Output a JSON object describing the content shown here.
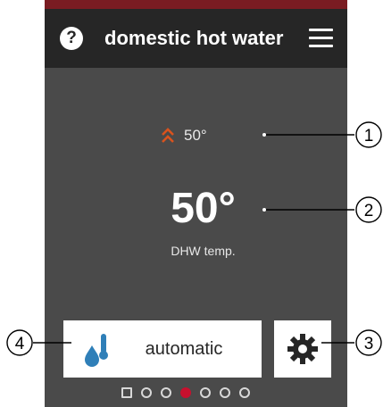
{
  "header": {
    "help_icon": "?",
    "title": "domestic hot water",
    "menu_icon": "hamburger-menu-icon"
  },
  "setpoint": {
    "icon": "double-chevron-up-icon",
    "value": "50°",
    "icon_color": "#d9531e"
  },
  "current_temp": {
    "value": "50°",
    "label": "DHW temp."
  },
  "mode": {
    "icon": "water-drop-thermometer-icon",
    "label": "automatic"
  },
  "settings": {
    "icon": "gear-icon"
  },
  "pagination": {
    "count": 7,
    "active_index": 3
  },
  "callouts": [
    "1",
    "2",
    "3",
    "4"
  ],
  "colors": {
    "accent": "#7a1c22",
    "active_dot": "#c8102e",
    "panel": "#4a4a4a",
    "header": "#262626",
    "icon_blue": "#2f7fb8"
  }
}
